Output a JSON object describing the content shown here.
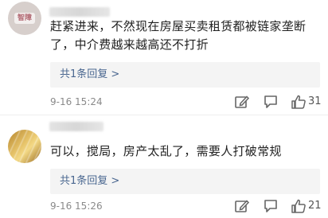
{
  "comments": [
    {
      "avatar_badge": "智障",
      "text": "赶紧进来，不然现在房屋买卖租赁都被链家垄断\n了，中介费越来越高还不打折",
      "replies_label": "共1条回复 >",
      "time": "9-16 15:24",
      "likes": "31"
    },
    {
      "text": "可以，搅局，房产太乱了，需要人打破常规",
      "replies_label": "共1条回复 >",
      "time": "9-16 15:26",
      "likes": "21"
    }
  ],
  "colors": {
    "link": "#4a6790",
    "meta": "#8a8a8a",
    "reply_bg": "#f4f4f4"
  },
  "icons": [
    "edit-icon",
    "comment-icon",
    "thumbs-up-icon"
  ]
}
